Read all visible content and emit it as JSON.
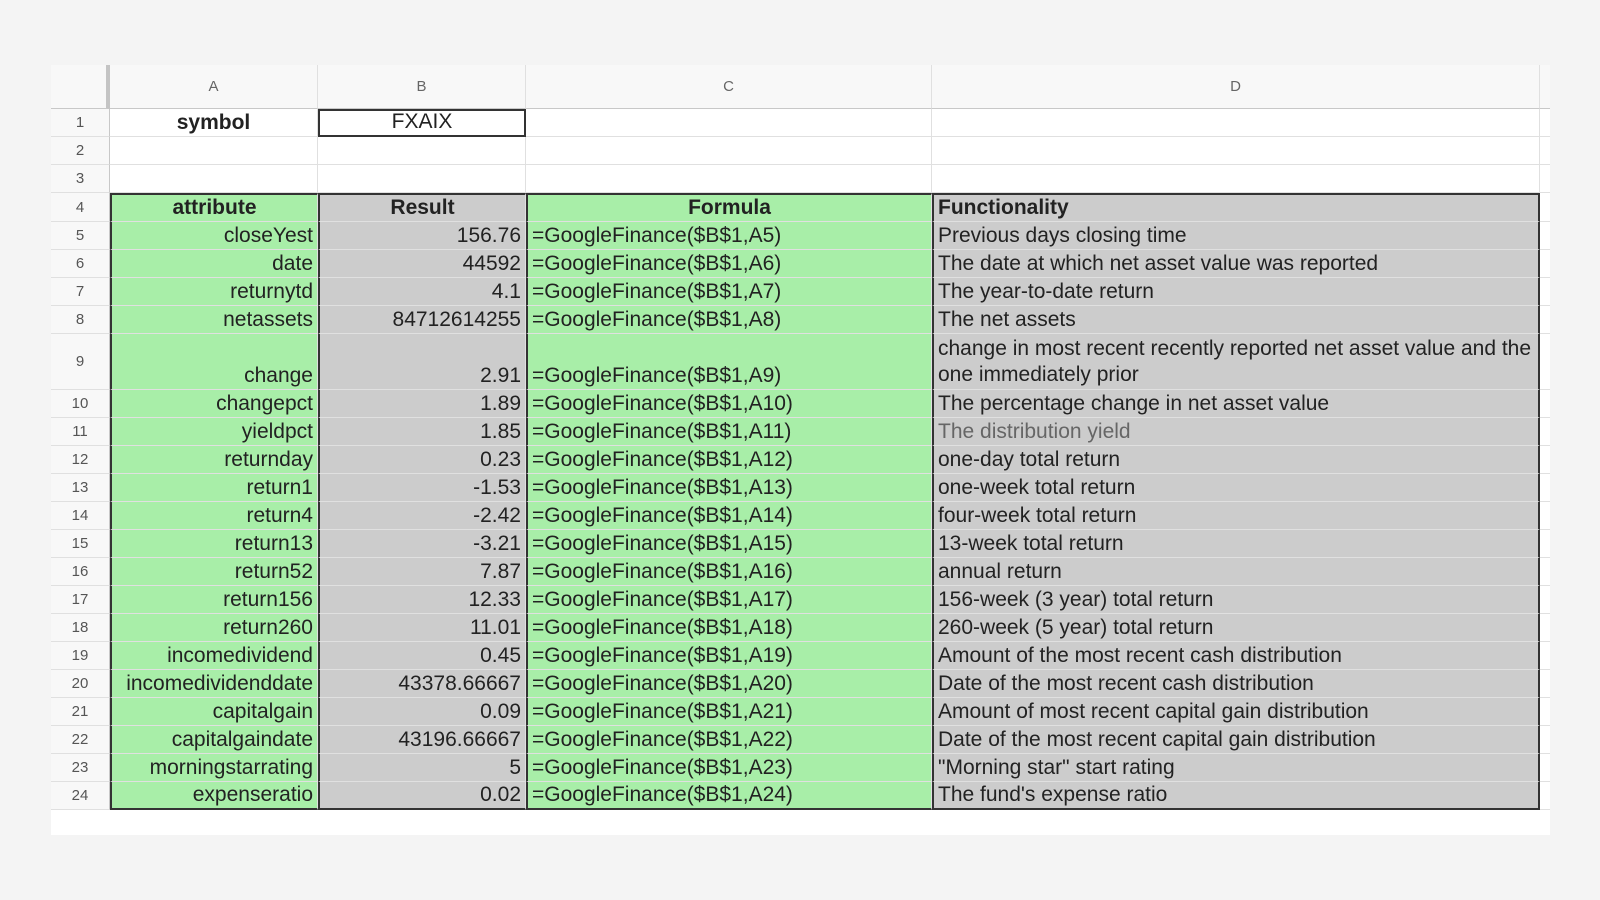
{
  "columns": [
    "A",
    "B",
    "C",
    "D"
  ],
  "symbol_row": {
    "row_number": "1",
    "label": "symbol",
    "value": "FXAIX"
  },
  "empty_rows": [
    "2",
    "3"
  ],
  "table_header": {
    "row_number": "4",
    "attribute": "attribute",
    "result": "Result",
    "formula": "Formula",
    "functionality": "Functionality"
  },
  "rows": [
    {
      "n": "5",
      "attribute": "closeYest",
      "result": "156.76",
      "formula": "=GoogleFinance($B$1,A5)",
      "functionality": "Previous days closing time"
    },
    {
      "n": "6",
      "attribute": "date",
      "result": "44592",
      "formula": "=GoogleFinance($B$1,A6)",
      "functionality": "The date at which net asset value was reported"
    },
    {
      "n": "7",
      "attribute": "returnytd",
      "result": "4.1",
      "formula": "=GoogleFinance($B$1,A7)",
      "functionality": "The year-to-date return"
    },
    {
      "n": "8",
      "attribute": "netassets",
      "result": "84712614255",
      "formula": "=GoogleFinance($B$1,A8)",
      "functionality": "The net assets"
    },
    {
      "n": "9",
      "attribute": "change",
      "result": "2.91",
      "formula": "=GoogleFinance($B$1,A9)",
      "functionality": "change in most recent recently reported net asset value and the one immediately prior"
    },
    {
      "n": "10",
      "attribute": "changepct",
      "result": "1.89",
      "formula": "=GoogleFinance($B$1,A10)",
      "functionality": "The percentage change in net asset value"
    },
    {
      "n": "11",
      "attribute": "yieldpct",
      "result": "1.85",
      "formula": "=GoogleFinance($B$1,A11)",
      "functionality": "The distribution yield"
    },
    {
      "n": "12",
      "attribute": "returnday",
      "result": "0.23",
      "formula": "=GoogleFinance($B$1,A12)",
      "functionality": "one-day total return"
    },
    {
      "n": "13",
      "attribute": "return1",
      "result": "-1.53",
      "formula": "=GoogleFinance($B$1,A13)",
      "functionality": "one-week total return"
    },
    {
      "n": "14",
      "attribute": "return4",
      "result": "-2.42",
      "formula": "=GoogleFinance($B$1,A14)",
      "functionality": "four-week total return"
    },
    {
      "n": "15",
      "attribute": "return13",
      "result": "-3.21",
      "formula": "=GoogleFinance($B$1,A15)",
      "functionality": "13-week total return"
    },
    {
      "n": "16",
      "attribute": "return52",
      "result": "7.87",
      "formula": "=GoogleFinance($B$1,A16)",
      "functionality": "annual return"
    },
    {
      "n": "17",
      "attribute": "return156",
      "result": "12.33",
      "formula": "=GoogleFinance($B$1,A17)",
      "functionality": "156-week (3 year) total return"
    },
    {
      "n": "18",
      "attribute": "return260",
      "result": "11.01",
      "formula": "=GoogleFinance($B$1,A18)",
      "functionality": "260-week (5 year) total return"
    },
    {
      "n": "19",
      "attribute": "incomedividend",
      "result": "0.45",
      "formula": "=GoogleFinance($B$1,A19)",
      "functionality": "Amount of the most recent cash distribution"
    },
    {
      "n": "20",
      "attribute": "incomedividenddate",
      "result": "43378.66667",
      "formula": "=GoogleFinance($B$1,A20)",
      "functionality": "Date of the most recent cash distribution"
    },
    {
      "n": "21",
      "attribute": "capitalgain",
      "result": "0.09",
      "formula": "=GoogleFinance($B$1,A21)",
      "functionality": "Amount of most recent capital gain distribution"
    },
    {
      "n": "22",
      "attribute": "capitalgaindate",
      "result": "43196.66667",
      "formula": "=GoogleFinance($B$1,A22)",
      "functionality": "Date of the most recent capital gain distribution"
    },
    {
      "n": "23",
      "attribute": "morningstarrating",
      "result": "5",
      "formula": "=GoogleFinance($B$1,A23)",
      "functionality": "\"Morning star\" start rating"
    },
    {
      "n": "24",
      "attribute": "expenseratio",
      "result": "0.02",
      "formula": "=GoogleFinance($B$1,A24)",
      "functionality": "The fund's expense ratio"
    }
  ]
}
